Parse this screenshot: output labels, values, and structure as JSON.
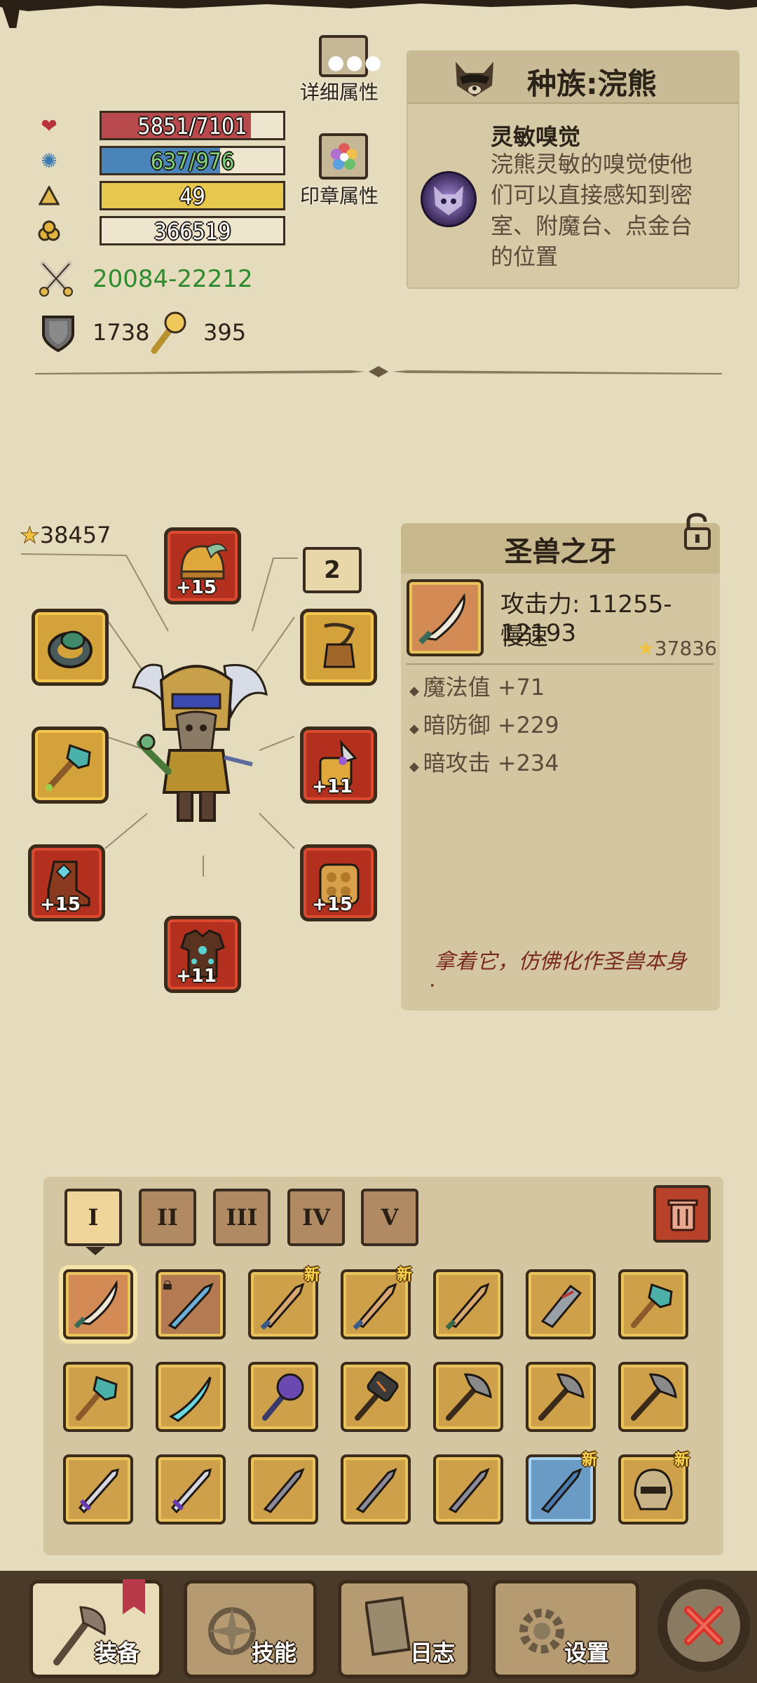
{
  "stats": {
    "hp": {
      "text": "5851/7101",
      "fraction": 0.824,
      "color": "#b84a4e"
    },
    "mp": {
      "text": "637/976",
      "fraction": 0.653,
      "color": "#4b84b8"
    },
    "level": {
      "text": "49",
      "fraction": 1.0,
      "color": "#e7c84f"
    },
    "gold": {
      "text": "366519"
    },
    "attack": "20084-22212",
    "defense": "1738",
    "magic": "395"
  },
  "buttons": {
    "details": "详细属性",
    "seal": "印章属性"
  },
  "race": {
    "title": "种族:浣熊",
    "skill_name": "灵敏嗅觉",
    "skill_desc": "浣熊灵敏的嗅觉使他们可以直接感知到密室、附魔台、点金台的位置"
  },
  "equipment": {
    "total_score": "38457",
    "ring_count": "2",
    "slots": {
      "helmet": "+15",
      "left_boot": "+15",
      "offhand": "+11",
      "glove": "+15",
      "armor": "+11"
    }
  },
  "item_detail": {
    "name": "圣兽之牙",
    "attack": "攻击力: 11255-12193",
    "speed": "慢速",
    "score": "37836",
    "attrs": [
      "魔法值 +71",
      "暗防御 +229",
      "暗攻击 +234"
    ],
    "flavor": "拿着它，仿佛化作圣兽本身",
    "flavor_end": "."
  },
  "inventory": {
    "tabs": [
      "I",
      "II",
      "III",
      "IV",
      "V"
    ],
    "new_label": "新"
  },
  "nav": {
    "equip": "装备",
    "skills": "技能",
    "log": "日志",
    "settings": "设置"
  },
  "colors": {
    "attack_text": "#2e8a2e",
    "flavor_text": "#7a2a1e"
  }
}
